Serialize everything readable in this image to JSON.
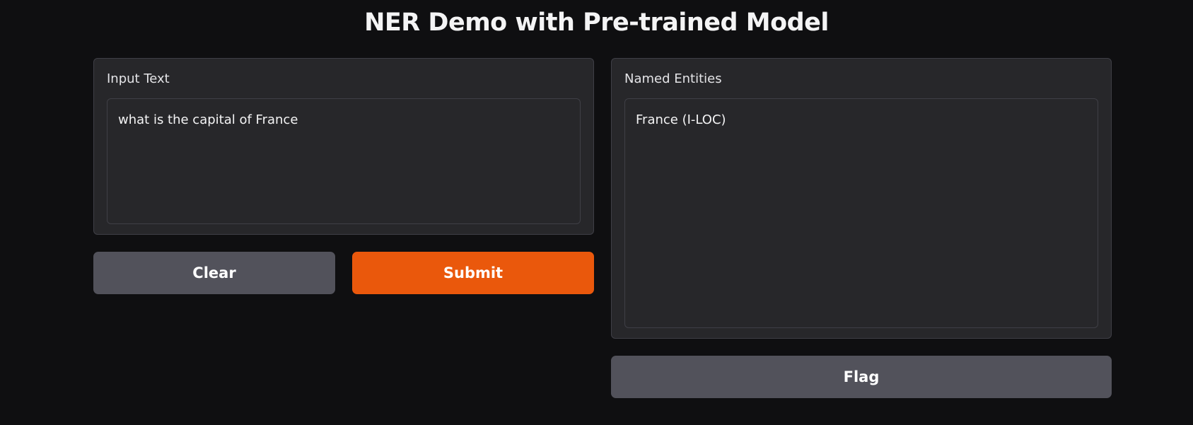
{
  "page": {
    "title": "NER Demo with Pre-trained Model"
  },
  "input_panel": {
    "label": "Input Text",
    "value": "what is the capital of France"
  },
  "output_panel": {
    "label": "Named Entities",
    "value": "France (I-LOC)"
  },
  "buttons": {
    "clear_label": "Clear",
    "submit_label": "Submit",
    "flag_label": "Flag"
  },
  "colors": {
    "background": "#0f0f11",
    "panel": "#27272a",
    "primary": "#ea580c",
    "secondary": "#52525b"
  }
}
